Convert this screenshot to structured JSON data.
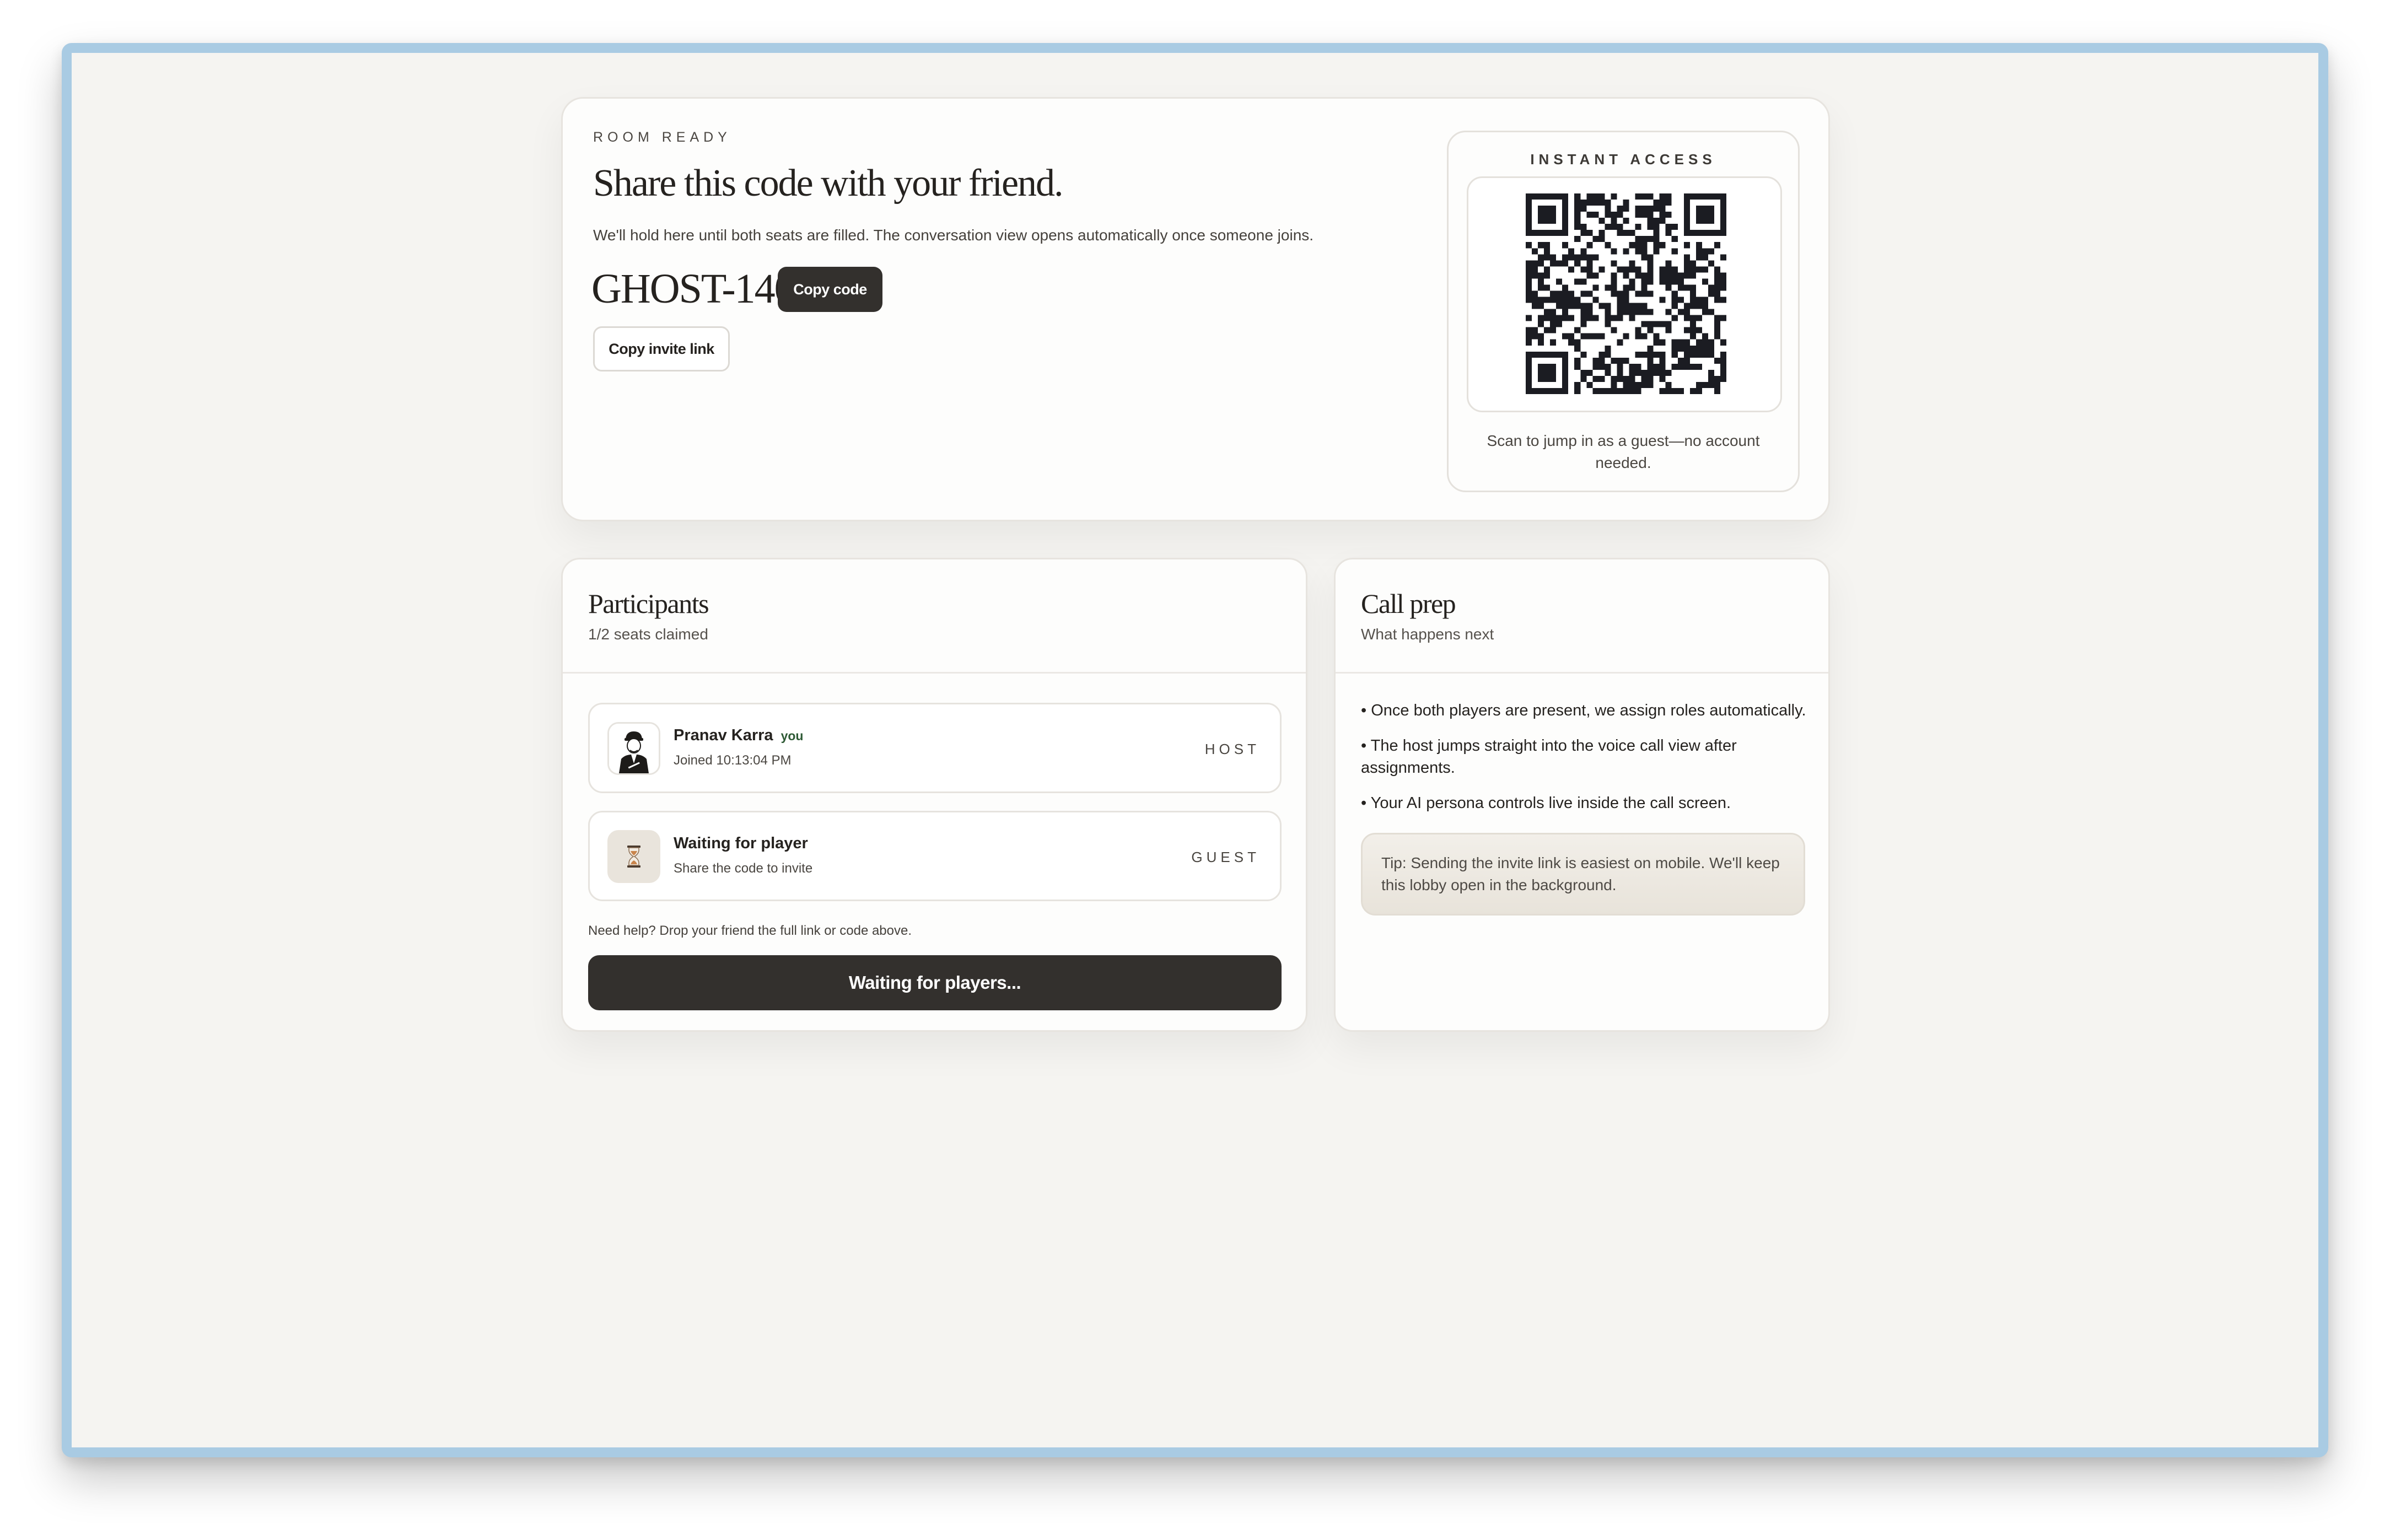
{
  "hero": {
    "eyebrow": "ROOM READY",
    "title": "Share this code with your friend.",
    "subtitle": "We'll hold here until both seats are filled. The conversation view opens automatically once someone joins.",
    "room_code": "GHOST-1404",
    "copy_code_label": "Copy code",
    "copy_link_label": "Copy invite link"
  },
  "qr": {
    "eyebrow": "INSTANT ACCESS",
    "caption": "Scan to jump in as a guest—no account needed."
  },
  "participants": {
    "title": "Participants",
    "subtitle": "1/2 seats claimed",
    "players": [
      {
        "name": "Pranav Karra",
        "tag": "you",
        "meta": "Joined 10:13:04 PM",
        "role": "HOST",
        "icon": "user-avatar"
      },
      {
        "name": "Waiting for player",
        "meta": "Share the code to invite",
        "role": "GUEST",
        "icon": "hourglass-icon"
      }
    ],
    "help_text": "Need help? Drop your friend the full link or code above.",
    "waiting_button": "Waiting for players..."
  },
  "call_prep": {
    "title": "Call prep",
    "subtitle": "What happens next",
    "bullets": [
      "• Once both players are present, we assign roles automatically.",
      "• The host jumps straight into the voice call view after assignments.",
      "• Your AI persona controls live inside the call screen."
    ],
    "tip": "Tip: Sending the invite link is easiest on mobile. We'll keep this lobby open in the background."
  },
  "colors": {
    "window_border": "#a9cbe3",
    "page_bg": "#f5f4f1",
    "dark_button": "#33302d",
    "you_tag": "#2e5a35"
  }
}
